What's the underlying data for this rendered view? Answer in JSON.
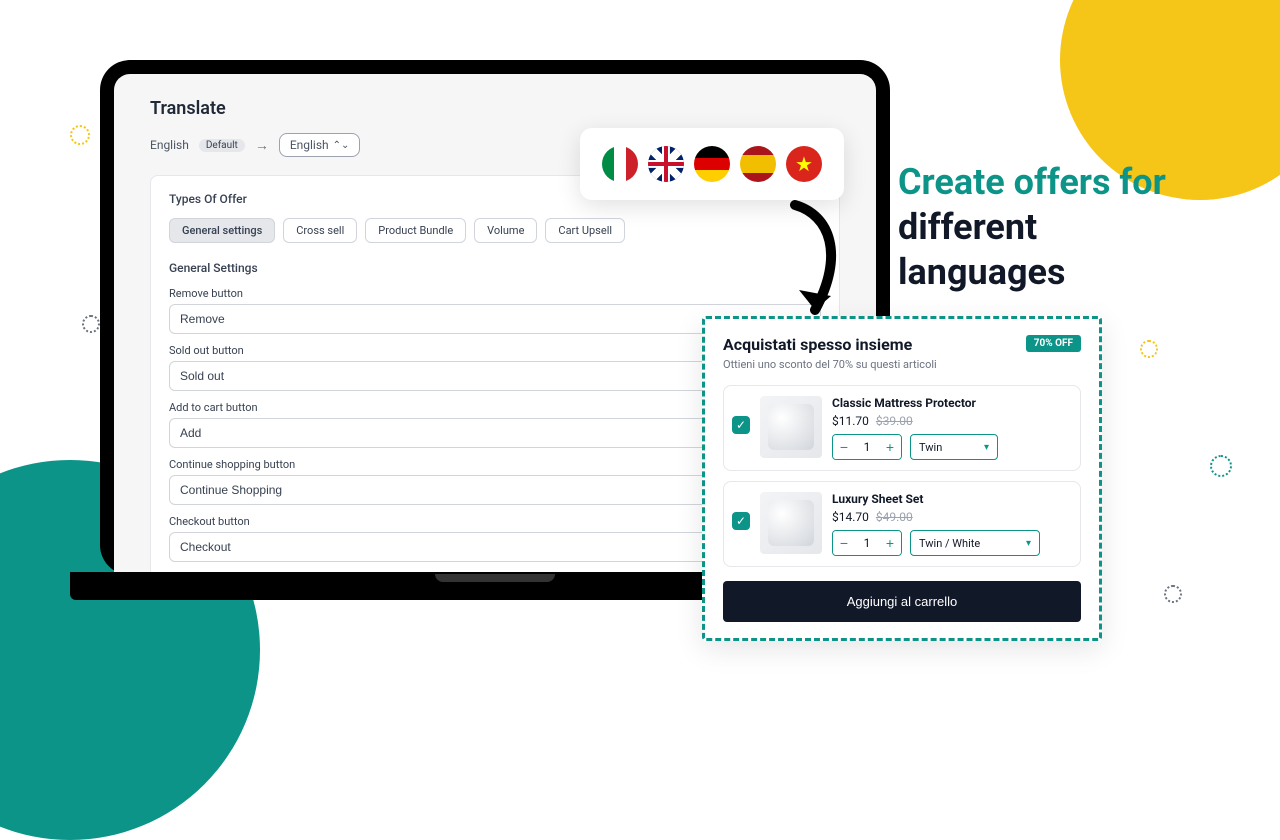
{
  "page": {
    "title": "Translate",
    "source_lang": "English",
    "default_pill": "Default",
    "target_lang": "English"
  },
  "card": {
    "types_title": "Types Of Offer",
    "tabs": [
      "General settings",
      "Cross sell",
      "Product Bundle",
      "Volume",
      "Cart Upsell"
    ],
    "section_title": "General Settings",
    "fields": [
      {
        "label": "Remove button",
        "value": "Remove"
      },
      {
        "label": "Sold out button",
        "value": "Sold out"
      },
      {
        "label": "Add to cart button",
        "value": "Add"
      },
      {
        "label": "Continue shopping button",
        "value": "Continue Shopping"
      },
      {
        "label": "Checkout button",
        "value": "Checkout"
      }
    ]
  },
  "flags": [
    "italy",
    "uk",
    "germany",
    "spain",
    "vietnam"
  ],
  "headline": {
    "line1": "Create offers for",
    "line2": "different",
    "line3": "languages"
  },
  "offer": {
    "title": "Acquistati spesso insieme",
    "badge": "70% OFF",
    "subtitle": "Ottieni uno sconto del 70% su questi articoli",
    "products": [
      {
        "name": "Classic Mattress Protector",
        "price": "$11.70",
        "old": "$39.00",
        "qty": "1",
        "variant": "Twin"
      },
      {
        "name": "Luxury Sheet Set",
        "price": "$14.70",
        "old": "$49.00",
        "qty": "1",
        "variant": "Twin / White"
      }
    ],
    "cta": "Aggiungi al carrello"
  }
}
